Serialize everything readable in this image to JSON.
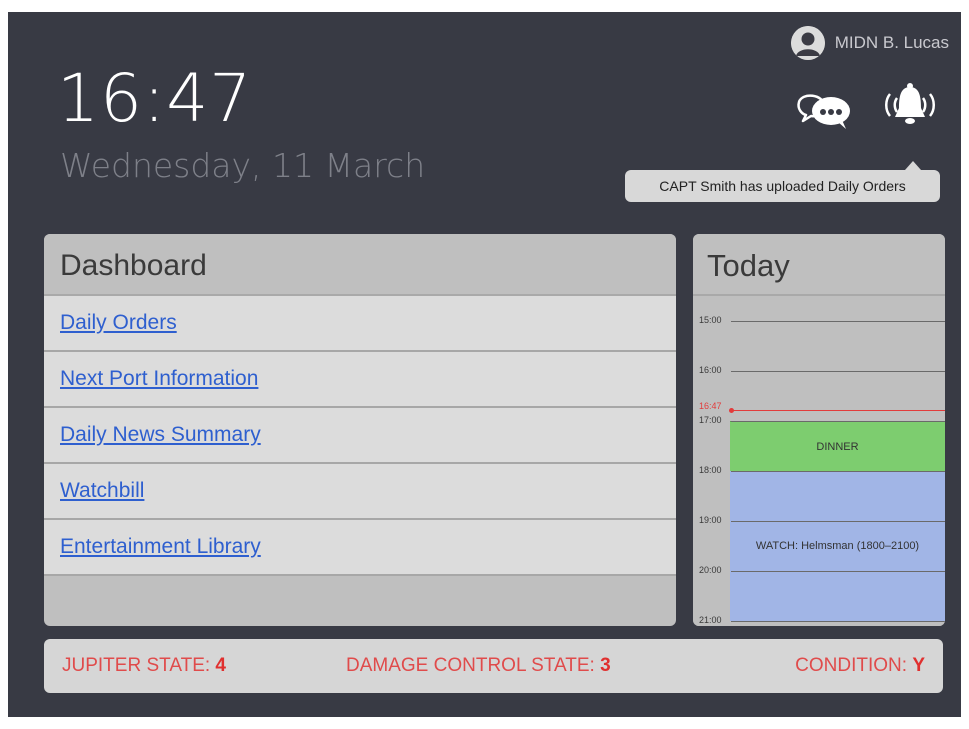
{
  "user": {
    "name": "MIDN B. Lucas",
    "avatar_icon": "user-avatar-icon"
  },
  "clock": {
    "time": "16:47",
    "date": "Wednesday, 11 March"
  },
  "notifications": {
    "chat_icon": "chat-bubbles-icon",
    "bell_icon": "ringing-bell-icon",
    "toast": "CAPT Smith has uploaded Daily Orders"
  },
  "dashboard": {
    "title": "Dashboard",
    "items": [
      {
        "label": "Daily Orders"
      },
      {
        "label": "Next Port Information"
      },
      {
        "label": "Daily News Summary"
      },
      {
        "label": "Watchbill"
      },
      {
        "label": "Entertainment Library"
      }
    ]
  },
  "today": {
    "title": "Today",
    "start_hour": 14.5,
    "end_hour": 21.1,
    "ticks": [
      "15:00",
      "16:00",
      "17:00",
      "18:00",
      "19:00",
      "20:00",
      "21:00"
    ],
    "now": "16:47",
    "now_hour": 16.783,
    "events": [
      {
        "label": "DINNER",
        "start": 17.0,
        "end": 18.0,
        "color": "#7dcd6f"
      },
      {
        "label": "WATCH: Helmsman (1800–2100)",
        "start": 18.0,
        "end": 21.0,
        "color": "#a1b5e6"
      }
    ]
  },
  "status": {
    "jupiter_label": "JUPITER STATE:",
    "jupiter_value": "4",
    "damage_label": "DAMAGE CONTROL STATE:",
    "damage_value": "3",
    "condition_label": "CONDITION:",
    "condition_value": "Y",
    "color": "#e04b4b"
  }
}
